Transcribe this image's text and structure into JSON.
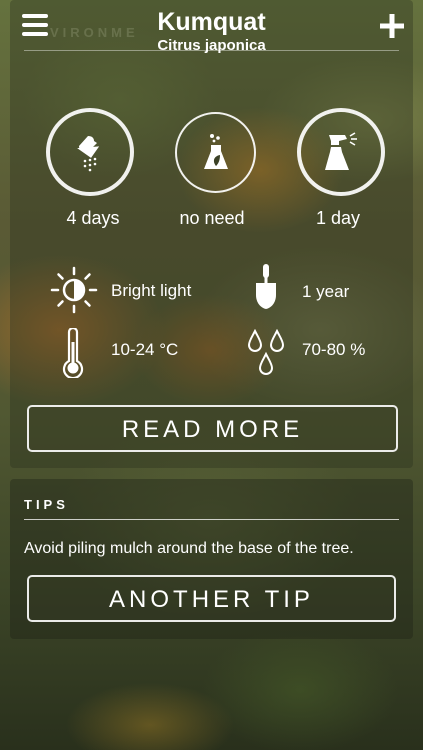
{
  "header": {
    "title": "Kumquat",
    "subtitle": "Citrus japonica",
    "menu_icon": "hamburger-menu-icon",
    "add_icon": "plus-icon"
  },
  "environment": {
    "section_label": "VIRONME",
    "care": [
      {
        "icon": "watering-shower-icon",
        "value": "4 days"
      },
      {
        "icon": "fertilizer-flask-icon",
        "value": "no need"
      },
      {
        "icon": "spray-bottle-icon",
        "value": "1 day"
      }
    ],
    "stats": {
      "light": "Bright light",
      "repot": "1 year",
      "temperature": "10-24 °C",
      "humidity": "70-80 %"
    },
    "read_more_label": "READ MORE"
  },
  "tips": {
    "section_label": "TIPS",
    "text": "Avoid piling mulch around the base of the tree.",
    "another_tip_label": "ANOTHER TIP"
  },
  "colors": {
    "text": "#ffffff",
    "panel": "rgba(40,45,30,0.35)"
  }
}
